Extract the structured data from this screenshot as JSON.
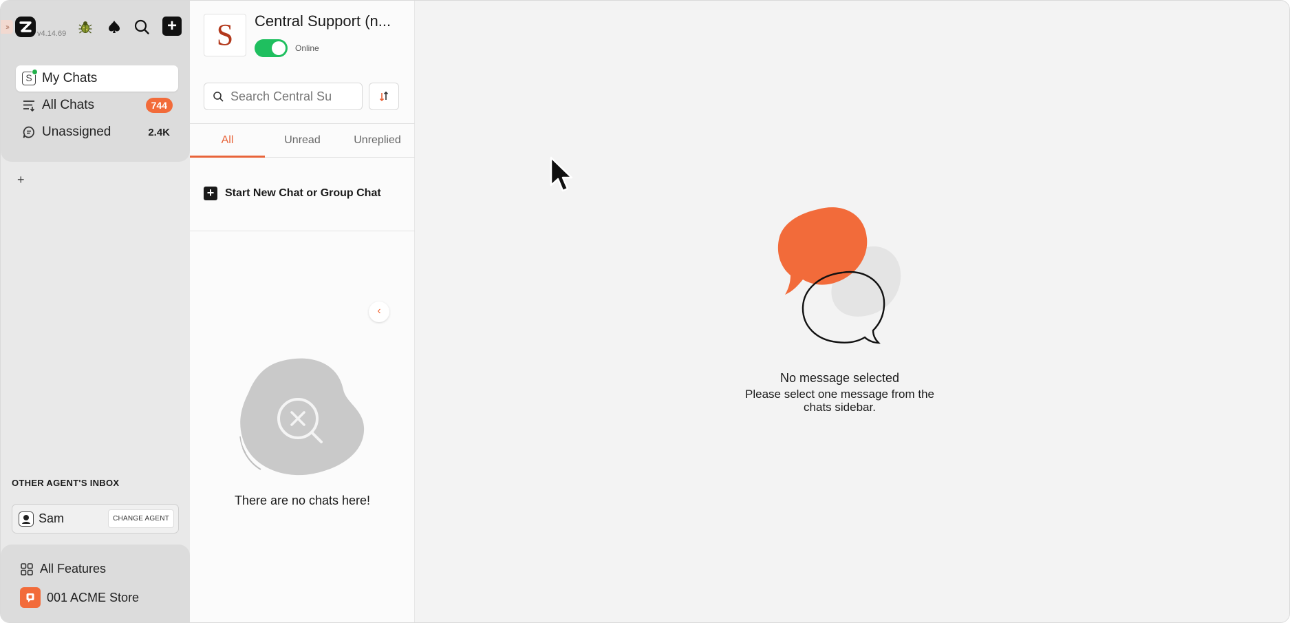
{
  "app": {
    "version": "v4.14.69"
  },
  "sidebar": {
    "nav": [
      {
        "label": "My Chats",
        "badge": ""
      },
      {
        "label": "All Chats",
        "badge": "744"
      },
      {
        "label": "Unassigned",
        "badge": "2.4K"
      }
    ],
    "add_label": "+",
    "other_inbox_title": "OTHER AGENT'S INBOX",
    "agent_name": "Sam",
    "change_agent_label": "CHANGE AGENT",
    "all_features_label": "All Features",
    "store_label": "001 ACME Store"
  },
  "chat_panel": {
    "inbox_initial": "S",
    "inbox_title": "Central Support (n...",
    "status": "Online",
    "search_placeholder": "Search Central Su",
    "tabs": [
      "All",
      "Unread",
      "Unreplied"
    ],
    "active_tab": "All",
    "new_chat_label": "Start New Chat or Group Chat",
    "empty_text": "There are no chats here!"
  },
  "main": {
    "empty_title": "No message selected",
    "empty_subtitle": "Please select one message from the chats sidebar."
  },
  "colors": {
    "accent": "#f26b3a",
    "online": "#1fbf5f",
    "sidebar_bg": "#e9e9e9"
  }
}
